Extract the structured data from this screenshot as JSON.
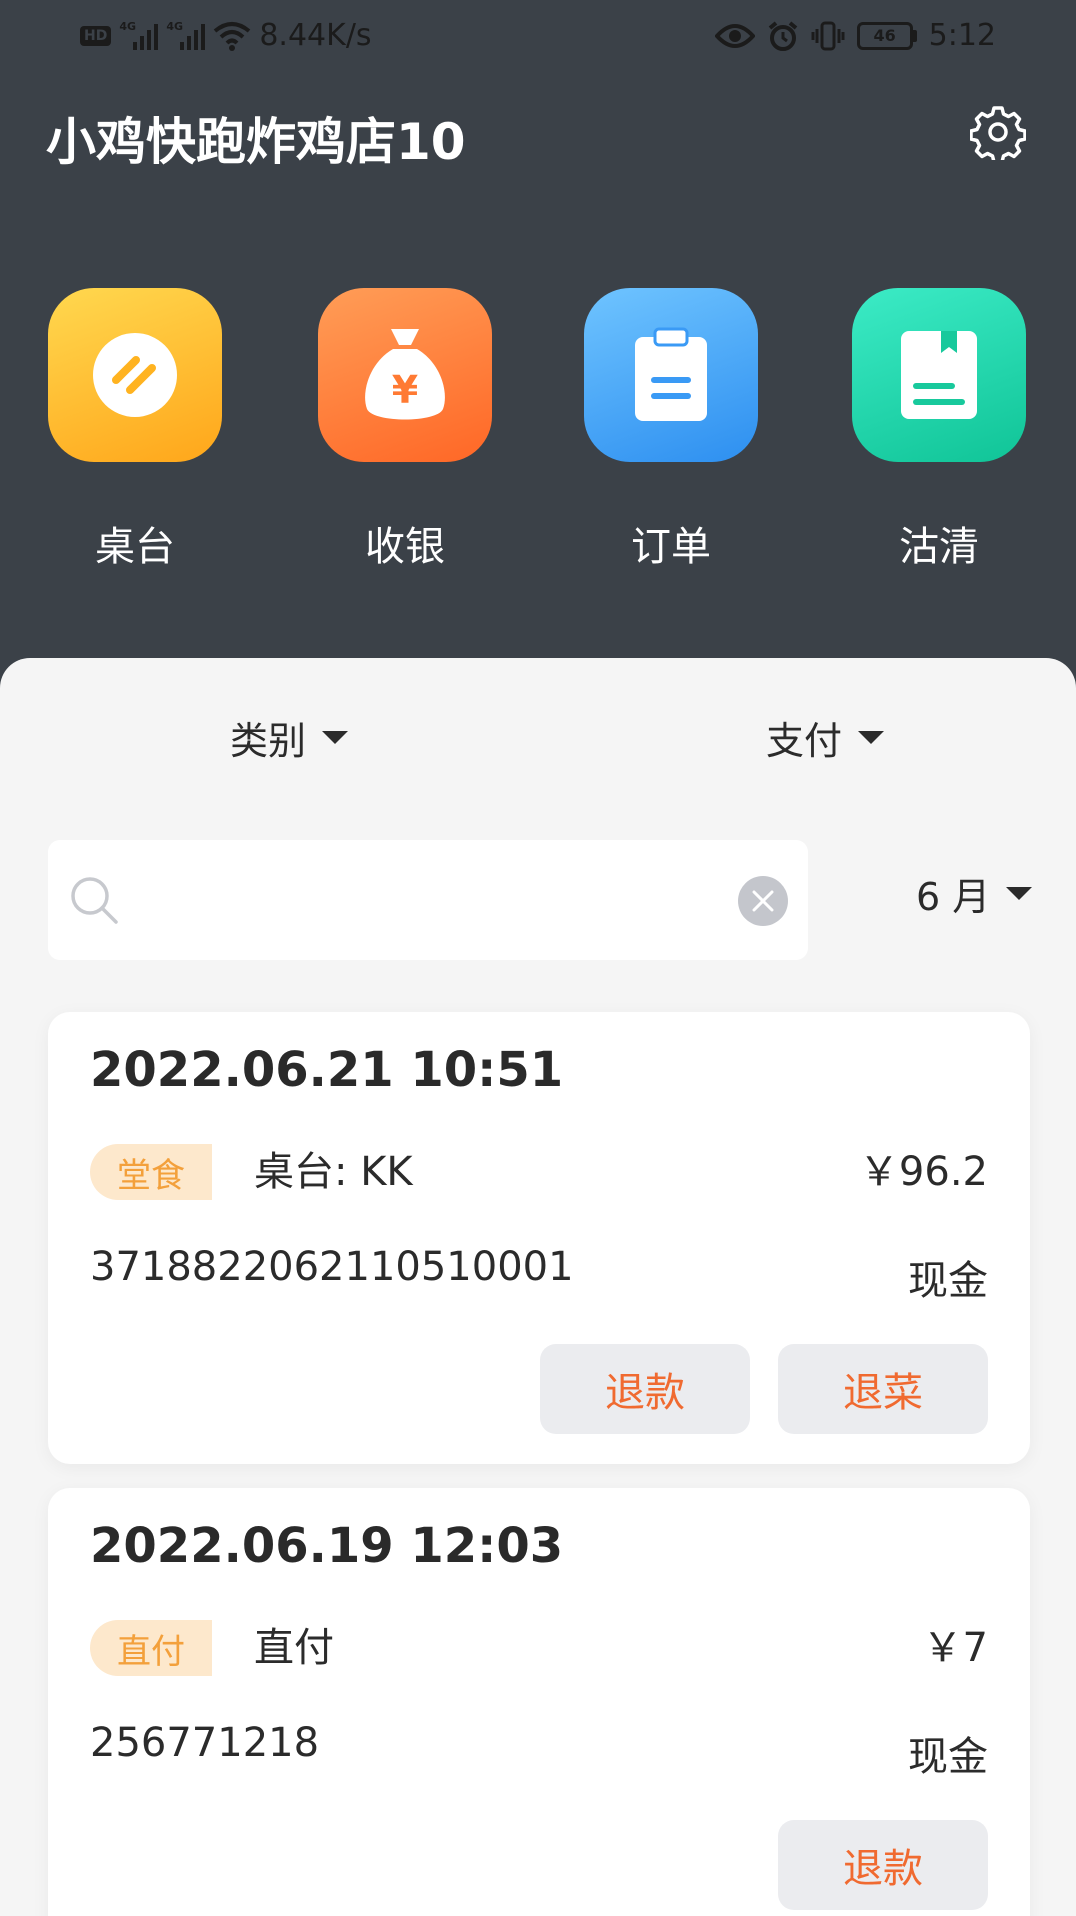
{
  "status_bar": {
    "net_speed": "8.44K/s",
    "battery": "46",
    "time": "5:12"
  },
  "header": {
    "store_name": "小鸡快跑炸鸡店10"
  },
  "quick_actions": [
    {
      "label": "桌台",
      "icon": "table-icon",
      "color_from": "#ffd24a",
      "color_to": "#ffa91c"
    },
    {
      "label": "收银",
      "icon": "money-bag-icon",
      "color_from": "#ff9a55",
      "color_to": "#ff6a2a"
    },
    {
      "label": "订单",
      "icon": "clipboard-icon",
      "color_from": "#6cc0ff",
      "color_to": "#2f92f2"
    },
    {
      "label": "沽清",
      "icon": "book-icon",
      "color_from": "#3be8c4",
      "color_to": "#12c79a"
    }
  ],
  "filters": {
    "category_label": "类别",
    "payment_label": "支付",
    "month_label": "6 月",
    "search_placeholder": ""
  },
  "orders": [
    {
      "datetime": "2022.06.21 10:51",
      "tag": "堂食",
      "table_info": "桌台:  KK",
      "amount": "￥96.2",
      "order_no": "371882206211051000 1",
      "payment": "现金",
      "buttons": [
        "退款",
        "退菜"
      ]
    },
    {
      "datetime": "2022.06.19 12:03",
      "tag": "直付",
      "table_info": "直付",
      "amount": "￥7",
      "order_no": "256771218",
      "payment": "现金",
      "buttons": [
        "退款"
      ]
    }
  ],
  "colors": {
    "header_bg": "#3b4148",
    "sheet_bg": "#f5f5f5",
    "tag_bg": "#fde8cc",
    "tag_text": "#f3a03b",
    "action_text": "#f06a30"
  }
}
